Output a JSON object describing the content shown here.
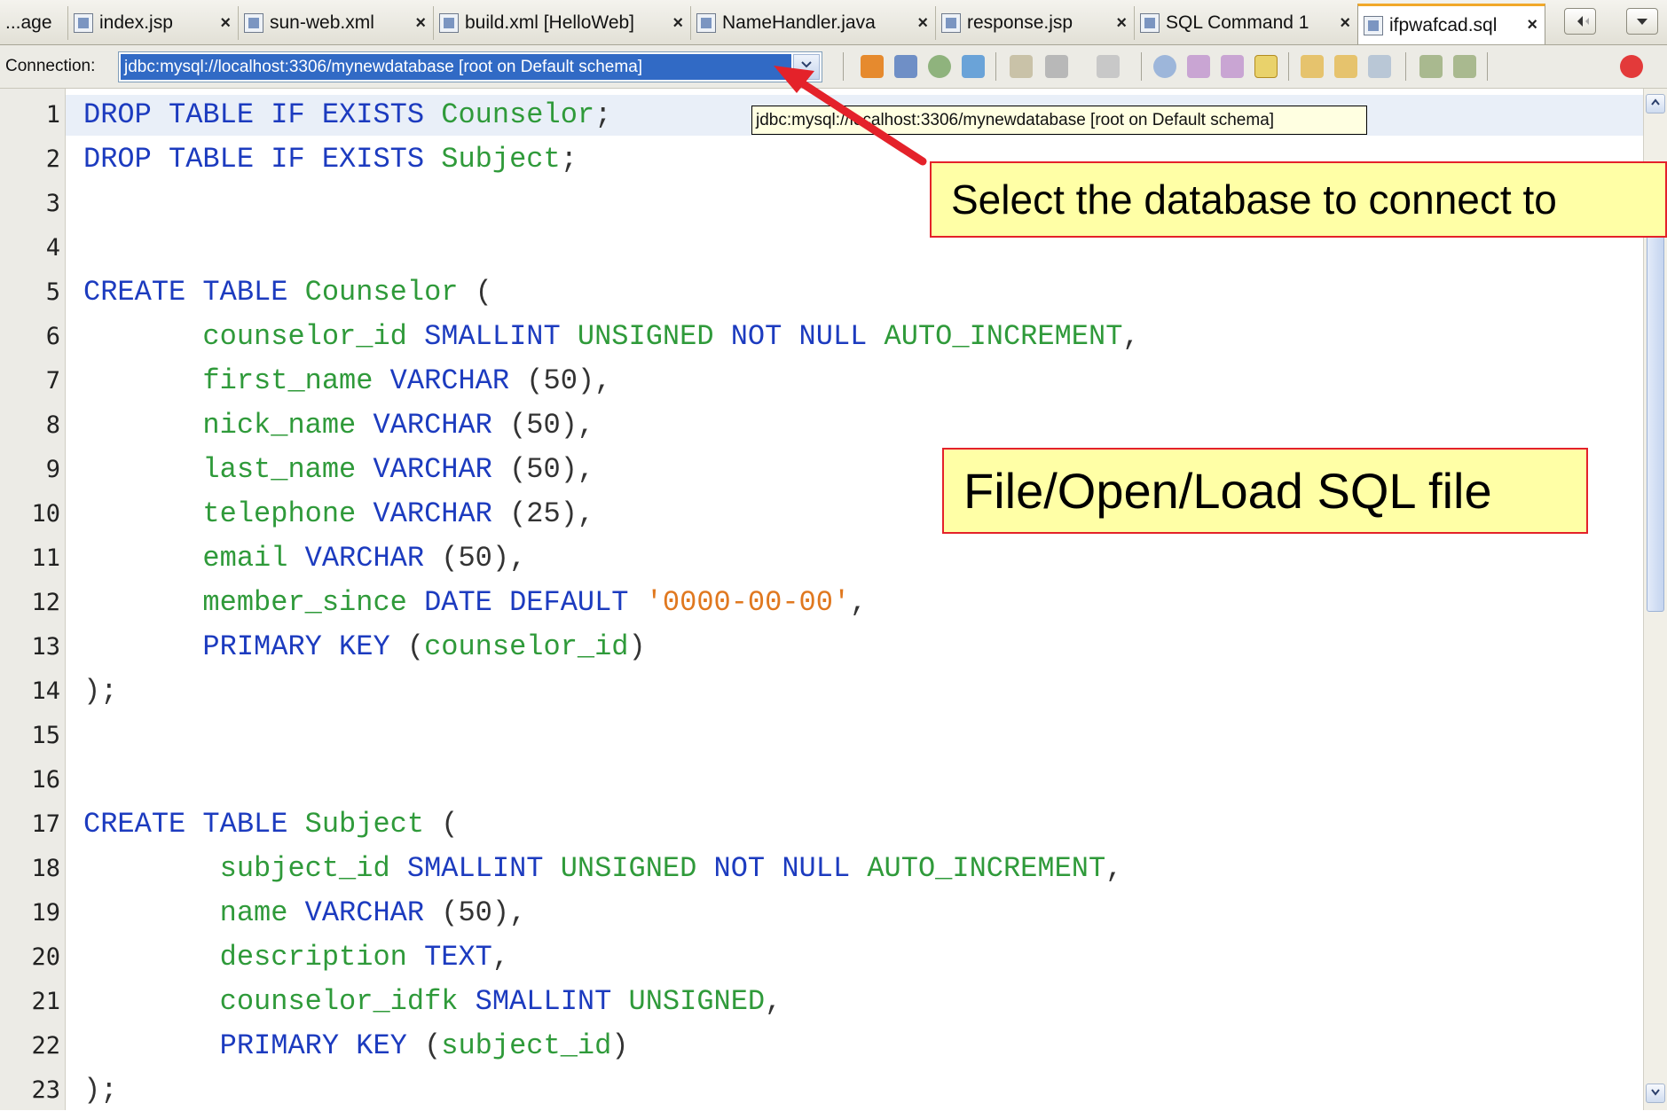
{
  "tabs": [
    {
      "label": "...age",
      "icon": "jsp-file-icon"
    },
    {
      "label": "index.jsp",
      "icon": "jsp-file-icon"
    },
    {
      "label": "sun-web.xml",
      "icon": "xml-file-icon"
    },
    {
      "label": "build.xml [HelloWeb]",
      "icon": "build-xml-icon"
    },
    {
      "label": "NameHandler.java",
      "icon": "java-file-icon"
    },
    {
      "label": "response.jsp",
      "icon": "jsp-file-icon"
    },
    {
      "label": "SQL Command 1",
      "icon": "sql-file-icon"
    },
    {
      "label": "ifpwafcad.sql",
      "icon": "sql-file-icon",
      "active": true
    }
  ],
  "tab_close_glyph": "×",
  "toolbar": {
    "connection_label": "Connection:",
    "connection_value": "jdbc:mysql://localhost:3306/mynewdatabase [root on Default schema]"
  },
  "tooltip": "jdbc:mysql://localhost:3306/mynewdatabase [root on Default schema]",
  "editor": {
    "line_numbers": [
      "1",
      "2",
      "3",
      "4",
      "5",
      "6",
      "7",
      "8",
      "9",
      "10",
      "11",
      "12",
      "13",
      "14",
      "15",
      "16",
      "17",
      "18",
      "19",
      "20",
      "21",
      "22",
      "23"
    ]
  },
  "callouts": {
    "select_db": "Select the database to connect to",
    "load_sql": "File/Open/Load SQL file"
  },
  "colors": {
    "keyword": "#1c3bbf",
    "identifier": "#2f9a3a",
    "string": "#e0781f",
    "callout_fill": "#ffffa6",
    "callout_border": "#e4222a",
    "arrow": "#e4222a",
    "selection": "#316ac5"
  }
}
